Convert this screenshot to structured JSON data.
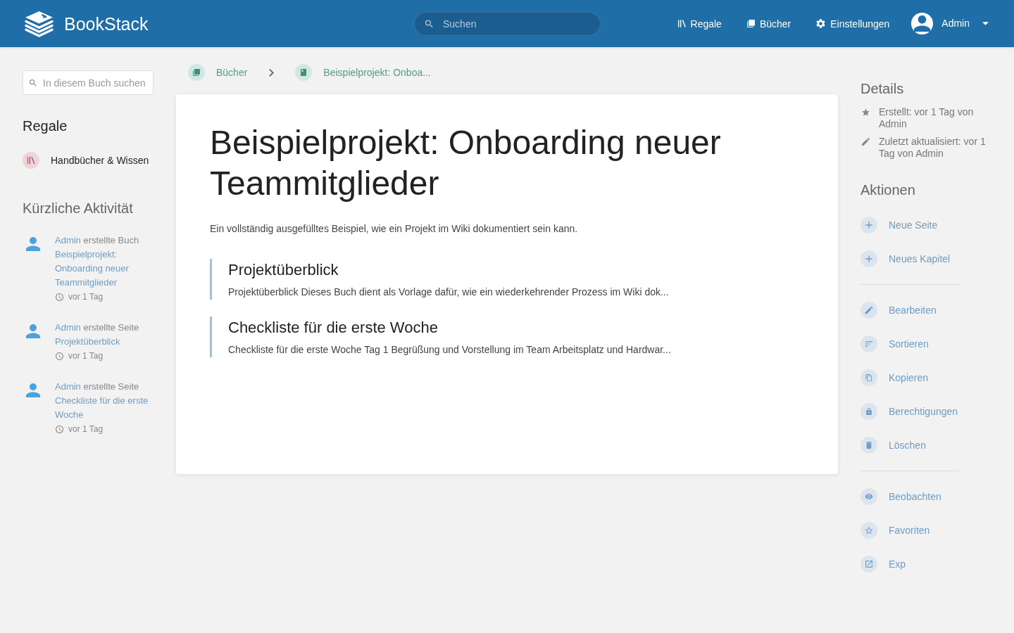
{
  "header": {
    "app_name": "BookStack",
    "search": {
      "placeholder": "Suchen"
    },
    "nav": [
      {
        "kind": "shelves",
        "label": "Regale"
      },
      {
        "kind": "books",
        "label": "Bücher"
      },
      {
        "kind": "settings",
        "label": "Einstellungen"
      }
    ],
    "user": {
      "name": "Admin"
    }
  },
  "left_sidebar": {
    "search": {
      "placeholder": "In diesem Buch suchen"
    },
    "shelves": {
      "title": "Regale",
      "items": [
        {
          "label": "Handbücher & Wissen"
        }
      ]
    },
    "activity": {
      "title": "Kürzliche Aktivität",
      "items": [
        {
          "user": "Admin",
          "action": "erstellte Buch",
          "entity": "Beispielprojekt: Onboarding neuer Teammitglieder",
          "time": "vor 1 Tag"
        },
        {
          "user": "Admin",
          "action": "erstellte Seite",
          "entity": "Projektüberblick",
          "time": "vor 1 Tag"
        },
        {
          "user": "Admin",
          "action": "erstellte Seite",
          "entity": "Checkliste für die erste Woche",
          "time": "vor 1 Tag"
        }
      ]
    }
  },
  "breadcrumbs": [
    {
      "kind": "books",
      "label": "Bücher"
    },
    {
      "kind": "book",
      "label": "Beispielprojekt: Onboa..."
    }
  ],
  "book": {
    "title": "Beispielprojekt: Onboarding neuer Teammitglieder",
    "description": "Ein vollständig ausgefülltes Beispiel, wie ein Projekt im Wiki dokumentiert sein kann.",
    "pages": [
      {
        "title": "Projektüberblick",
        "excerpt": "Projektüberblick Dieses Buch dient als Vorlage dafür, wie ein wiederkehrender Prozess im Wiki dok..."
      },
      {
        "title": "Checkliste für die erste Woche",
        "excerpt": "Checkliste für die erste Woche Tag 1 Begrüßung und Vorstellung im Team Arbeitsplatz und Hardwar..."
      }
    ]
  },
  "right_sidebar": {
    "details": {
      "title": "Details",
      "items": [
        {
          "kind": "created",
          "text": "Erstellt: vor 1 Tag von Admin"
        },
        {
          "kind": "updated",
          "text": "Zuletzt aktualisiert: vor 1 Tag von Admin"
        }
      ]
    },
    "actions": {
      "title": "Aktionen",
      "groups": [
        {
          "items": [
            {
              "kind": "new-page",
              "label": "Neue Seite"
            },
            {
              "kind": "new-chapter",
              "label": "Neues Kapitel"
            }
          ]
        },
        {
          "items": [
            {
              "kind": "edit",
              "label": "Bearbeiten"
            },
            {
              "kind": "sort",
              "label": "Sortieren"
            },
            {
              "kind": "copy",
              "label": "Kopieren"
            },
            {
              "kind": "permissions",
              "label": "Berechtigungen"
            },
            {
              "kind": "delete",
              "label": "Löschen"
            }
          ]
        },
        {
          "items": [
            {
              "kind": "watch",
              "label": "Beobachten"
            },
            {
              "kind": "favorite",
              "label": "Favoriten"
            },
            {
              "kind": "export",
              "label": "Exp"
            }
          ]
        }
      ]
    }
  }
}
